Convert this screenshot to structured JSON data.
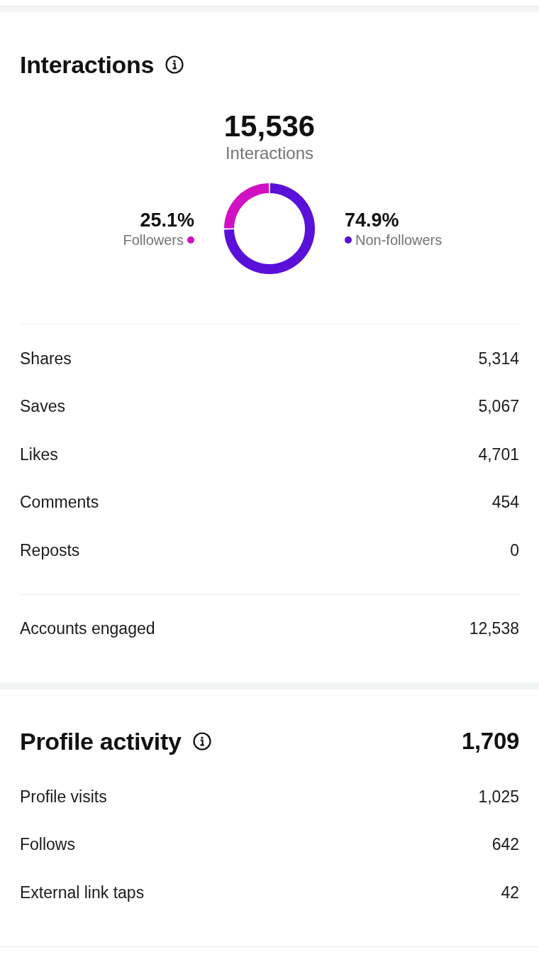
{
  "interactions": {
    "title": "Interactions",
    "total": "15,536",
    "total_label": "Interactions",
    "audience_split": [
      {
        "percent": "25.1%",
        "color": "#d10fc3"
      },
      {
        "percent": "74.9%",
        "color": "#5a10d9"
      }
    ],
    "chart_data": {
      "type": "donut",
      "categories": [
        "Followers",
        "Non-followers"
      ],
      "values": [
        25.1,
        74.9
      ]
    },
    "metrics": [
      {
        "label": "Shares",
        "value": "5,314"
      },
      {
        "label": "Saves",
        "value": "5,067"
      },
      {
        "label": "Likes",
        "value": "4,701"
      },
      {
        "label": "Comments",
        "value": "454"
      },
      {
        "label": "Reposts",
        "value": "0"
      }
    ],
    "summary": [
      {
        "label": "Accounts engaged",
        "value": "12,538"
      }
    ]
  },
  "profile_activity": {
    "title": "Profile activity",
    "total": "1,709",
    "metrics": [
      {
        "label": "Profile visits",
        "value": "1,025"
      },
      {
        "label": "Follows",
        "value": "642"
      },
      {
        "label": "External link taps",
        "value": "42"
      }
    ]
  }
}
